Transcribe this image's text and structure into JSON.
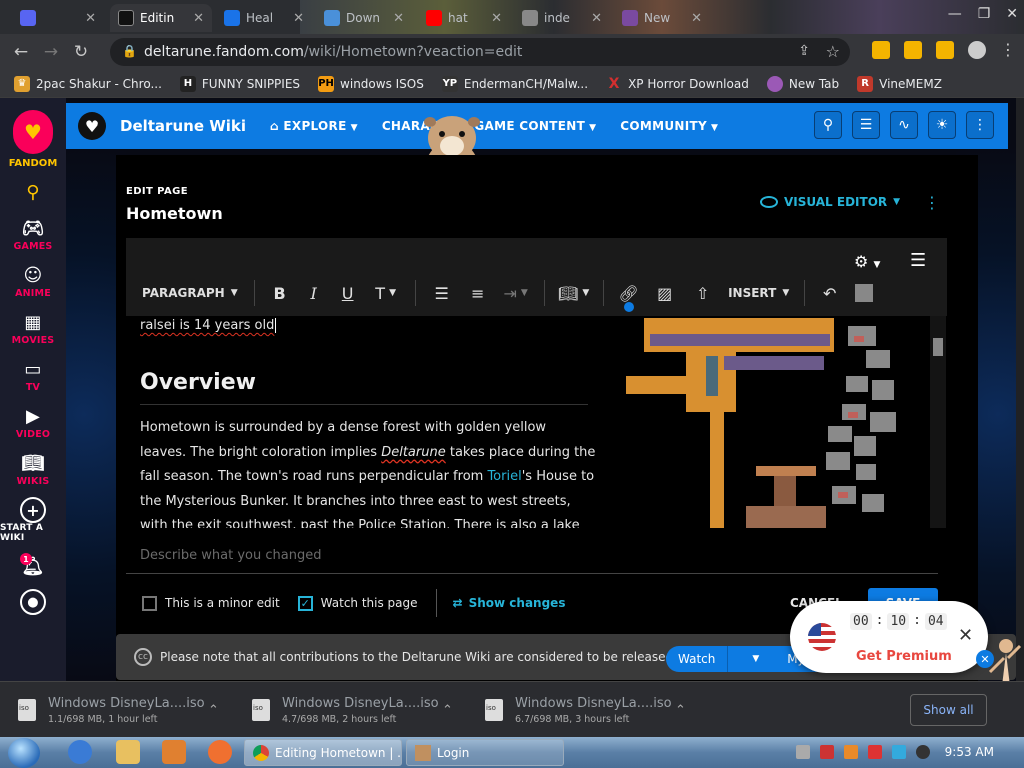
{
  "browser": {
    "tabs": [
      {
        "label": "",
        "color": "#5865f2"
      },
      {
        "label": "Editin",
        "color": "#222222",
        "active": true
      },
      {
        "label": "Heal",
        "color": "#1a73e8"
      },
      {
        "label": "Down",
        "color": "#4a90d9"
      },
      {
        "label": "hat",
        "color": "#ff0000"
      },
      {
        "label": "inde",
        "color": "#888888"
      },
      {
        "label": "New",
        "color": "#7a4aa0"
      }
    ],
    "url_host": "deltarune.fandom.com",
    "url_path": "/wiki/Hometown?veaction=edit",
    "bookmarks": [
      {
        "label": "2pac Shakur - Chro...",
        "icon": "crown-icon",
        "color": "#e0a030"
      },
      {
        "label": "FUNNY SNIPPIES",
        "icon": "H",
        "color": "#222222"
      },
      {
        "label": "windows ISOS",
        "icon": "PH",
        "color": "#f39c12"
      },
      {
        "label": "EndermanCH/Malw...",
        "icon": "YP",
        "color": "#333333"
      },
      {
        "label": "XP Horror Download",
        "icon": "X",
        "color": "#d32f2f"
      },
      {
        "label": "New Tab",
        "icon": "globe-icon",
        "color": "#9b59b6"
      },
      {
        "label": "VineMEMZ",
        "icon": "R",
        "color": "#c0392b"
      }
    ]
  },
  "sidebar": {
    "brand": "FANDOM",
    "items": [
      "GAMES",
      "ANIME",
      "MOVIES",
      "TV",
      "VIDEO",
      "WIKIS",
      "START A WIKI"
    ],
    "badge": "1"
  },
  "wiki": {
    "name": "Deltarune Wiki",
    "nav": [
      "EXPLORE",
      "CHARAC",
      "GAME CONTENT",
      "COMMUNITY"
    ]
  },
  "editor": {
    "label": "EDIT PAGE",
    "title": "Hometown",
    "visual_editor": "VISUAL EDITOR",
    "paragraph": "PARAGRAPH",
    "insert": "INSERT",
    "edit_line": "ralsei is 14 years old",
    "heading": "Overview",
    "para_1": "Hometown is surrounded by a dense forest with golden yellow leaves. The bright coloration implies ",
    "para_italic": "Deltarune",
    "para_2": " takes place during the fall season. The town's road runs perpendicular from ",
    "para_link": "Toriel",
    "para_3": "'s House to the Mysterious Bunker. It branches into three east to west streets, with the exit southwest, past the Police Station. There is also a lake",
    "summary_placeholder": "Describe what you changed",
    "minor_edit": "This is a minor edit",
    "watch_page": "Watch this page",
    "show_changes": "Show changes",
    "cancel": "CANCEL",
    "save": "SAVE"
  },
  "notice": {
    "text": "Please note that all contributions to the Deltarune Wiki are considered to be released under",
    "watch": "Watch",
    "tools": "My Tools"
  },
  "vpn": {
    "hh": "00",
    "mm": "10",
    "ss": "04",
    "premium": "Get Premium"
  },
  "downloads": [
    {
      "name": "Windows DisneyLa....iso",
      "status": "1.1/698 MB, 1 hour left"
    },
    {
      "name": "Windows DisneyLa....iso",
      "status": "4.7/698 MB, 2 hours left"
    },
    {
      "name": "Windows DisneyLa....iso",
      "status": "6.7/698 MB, 3 hours left"
    }
  ],
  "show_all": "Show all",
  "taskbar": {
    "windows": [
      "Editing Hometown | ...",
      "Login"
    ],
    "clock": "9:53 AM"
  }
}
